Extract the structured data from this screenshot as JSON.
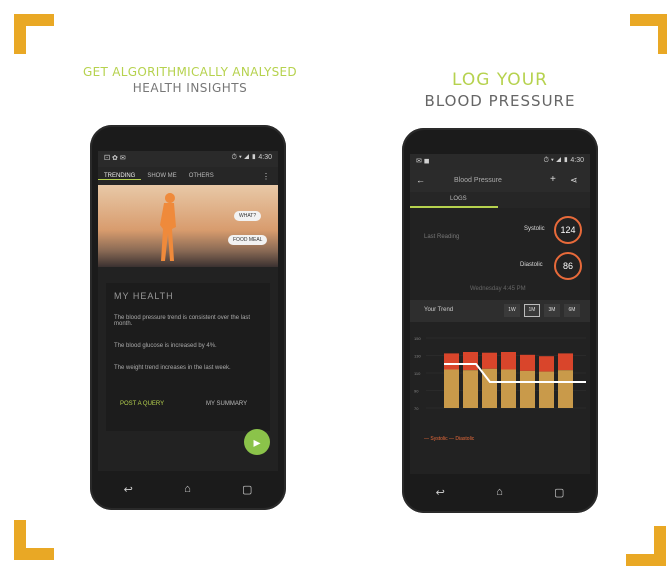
{
  "colors": {
    "accent": "#e9a825",
    "brand_green": "#b6d24e",
    "bp_red": "#e86a3a",
    "bp_bar_top": "#d9452b",
    "bp_bar_bottom": "#c99a4a"
  },
  "left_panel": {
    "heading_line1": "GET ALGORITHMICALLY ANALYSED",
    "heading_line2": "HEALTH INSIGHTS",
    "status_left": "⚀ ✿ ✉",
    "status_right": "⏱ ▾ ◢ ▮ 4:30",
    "tabs": [
      "TRENDING",
      "SHOW ME",
      "OTHERS"
    ],
    "tab_menu_icon": "kebab-menu-icon",
    "hero_pill_1": "WHAT?",
    "hero_pill_2": "FOOD MEAL",
    "card_title": "MY HEALTH",
    "card_lines": [
      "The blood pressure trend is consistent over the last month.",
      "The blood glucose is increased by 4%.",
      "The weight trend increases in the last week."
    ],
    "btn_primary": "POST A QUERY",
    "btn_secondary": "MY SUMMARY",
    "fab_icon": "play-icon"
  },
  "right_panel": {
    "heading_line1": "LOG YOUR",
    "heading_line2": "BLOOD PRESSURE",
    "status_left": "✉ ◼",
    "status_right": "⏱ ▾ ◢ ▮ 4:30",
    "toolbar_title": "Blood Pressure",
    "tab_label": "LOGS",
    "reading_time": "Last Reading",
    "systolic_label": "Systolic",
    "systolic_value": "124",
    "diastolic_label": "Diastolic",
    "diastolic_value": "86",
    "reading_note": "Wednesday 4:45 PM",
    "trend_label": "Your Trend",
    "periods": [
      "1W",
      "1M",
      "3M",
      "6M"
    ],
    "legend_text": "— Systolic  — Diastolic",
    "chart_y_labels": [
      "150",
      "130",
      "110",
      "90",
      "70"
    ],
    "chart_bars": [
      {
        "sys": 0.78,
        "dia": 0.55
      },
      {
        "sys": 0.8,
        "dia": 0.54
      },
      {
        "sys": 0.79,
        "dia": 0.56
      },
      {
        "sys": 0.8,
        "dia": 0.55
      },
      {
        "sys": 0.76,
        "dia": 0.53
      },
      {
        "sys": 0.74,
        "dia": 0.52
      },
      {
        "sys": 0.78,
        "dia": 0.54
      }
    ]
  }
}
